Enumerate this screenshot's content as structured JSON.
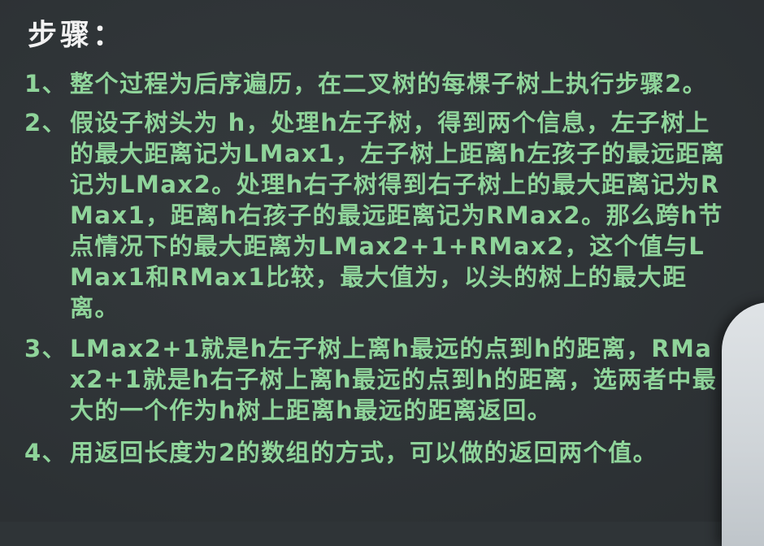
{
  "title": "步骤：",
  "steps": [
    {
      "num": "1、",
      "text": "整个过程为后序遍历，在二叉树的每棵子树上执行步骤2。"
    },
    {
      "num": "2、",
      "text": "假设子树头为 h，处理h左子树，得到两个信息，左子树上的最大距离记为LMax1，左子树上距离h左孩子的最远距离记为LMax2。处理h右子树得到右子树上的最大距离记为RMax1，距离h右孩子的最远距离记为RMax2。那么跨h节点情况下的最大距离为LMax2+1+RMax2，这个值与LMax1和RMax1比较，最大值为，以头的树上的最大距离。"
    },
    {
      "num": "3、",
      "text": "LMax2+1就是h左子树上离h最远的点到h的距离，RMax2+1就是h右子树上离h最远的点到h的距离，选两者中最大的一个作为h树上距离h最远的距离返回。"
    },
    {
      "num": "4、",
      "text": "用返回长度为2的数组的方式，可以做的返回两个值。"
    }
  ]
}
